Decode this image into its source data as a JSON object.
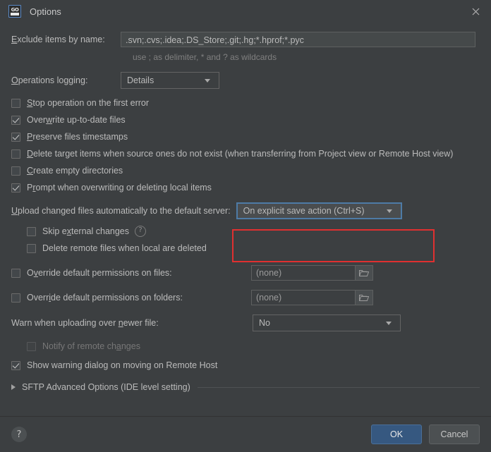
{
  "window": {
    "title": "Options",
    "app_icon": "goland-icon",
    "close_label": "×"
  },
  "form": {
    "exclude_label": "Exclude items by name:",
    "exclude_mnemonic": "E",
    "exclude_value": ".svn;.cvs;.idea;.DS_Store;.git;.hg;*.hprof;*.pyc",
    "exclude_hint": "use ; as delimiter, * and ? as wildcards",
    "operations_logging_label": "Operations logging:",
    "operations_logging_mnemonic": "O",
    "operations_logging_value": "Details",
    "upload_label": "Upload changed files automatically to the default server:",
    "upload_mnemonic": "U",
    "upload_value": "On explicit save action (Ctrl+S)",
    "warn_newer_label": "Warn when uploading over newer file:",
    "warn_newer_mnemonic": "n",
    "warn_newer_value": "No",
    "override_files_label": "Override default permissions on files:",
    "override_files_mnemonic": "v",
    "override_files_value": "(none)",
    "override_folders_label": "Override default permissions on folders:",
    "override_folders_mnemonic": "i",
    "override_folders_value": "(none)",
    "browse_icon": "folder-icon",
    "help_icon": "question-circle-icon"
  },
  "checkboxes": [
    {
      "name": "stop-operation-on-first-error",
      "label": "Stop operation on the first error",
      "pre": "S",
      "checked": false,
      "disabled": false,
      "indent": 0
    },
    {
      "name": "overwrite-up-to-date-files",
      "label": "Overwrite up-to-date files",
      "pre": "w",
      "checked": true,
      "disabled": false,
      "indent": 0
    },
    {
      "name": "preserve-files-timestamps",
      "label": "Preserve files timestamps",
      "pre": "P",
      "checked": true,
      "disabled": false,
      "indent": 0
    },
    {
      "name": "delete-target-items",
      "label": "Delete target items when source ones do not exist (when transferring from Project view or Remote Host view)",
      "pre": "D",
      "checked": false,
      "disabled": false,
      "indent": 0
    },
    {
      "name": "create-empty-directories",
      "label": "Create empty directories",
      "pre": "C",
      "checked": false,
      "disabled": false,
      "indent": 0
    },
    {
      "name": "prompt-when-overwriting",
      "label": "Prompt when overwriting or deleting local items",
      "pre": "r",
      "checked": true,
      "disabled": false,
      "indent": 0
    }
  ],
  "sub_checkboxes": [
    {
      "name": "skip-external-changes",
      "label": "Skip external changes",
      "pre": "x",
      "checked": false,
      "disabled": false,
      "has_help": true
    },
    {
      "name": "delete-remote-files-when-local-deleted",
      "label": "Delete remote files when local are deleted",
      "pre": "",
      "checked": false,
      "disabled": false,
      "has_help": false
    }
  ],
  "notify_checkbox": {
    "name": "notify-of-remote-changes",
    "label": "Notify of remote changes",
    "pre": "a",
    "checked": false,
    "disabled": true
  },
  "show_warning_checkbox": {
    "name": "show-warning-dialog-on-moving",
    "label": "Show warning dialog on moving on Remote Host",
    "checked": true,
    "disabled": false
  },
  "advanced": {
    "label": "SFTP Advanced Options (IDE level setting)",
    "expanded": false,
    "triangle_icon": "chevron-right-icon"
  },
  "footer": {
    "help_label": "?",
    "ok_label": "OK",
    "cancel_label": "Cancel"
  },
  "annotation": {
    "color": "#e03030",
    "target": "upload-combo"
  }
}
